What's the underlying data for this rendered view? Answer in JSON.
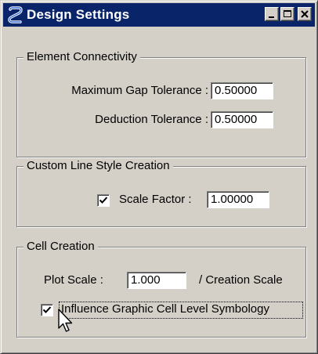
{
  "window": {
    "title": "Design Settings",
    "title_bar_color": "#0a246a",
    "face_color": "#d4d0c8",
    "controls": [
      "minimize-icon",
      "maximize-icon",
      "close-icon"
    ]
  },
  "element_connectivity": {
    "legend": "Element Connectivity",
    "max_gap_label": "Maximum Gap Tolerance :",
    "max_gap_value": "0.50000",
    "deduction_label": "Deduction Tolerance :",
    "deduction_value": "0.50000"
  },
  "custom_line_style": {
    "legend": "Custom Line Style Creation",
    "scale_factor_checked": true,
    "scale_factor_label": "Scale Factor :",
    "scale_factor_value": "1.00000"
  },
  "cell_creation": {
    "legend": "Cell Creation",
    "plot_scale_label": "Plot Scale :",
    "plot_scale_value": "1.000",
    "creation_scale_label": "/ Creation Scale",
    "influence_checked": true,
    "influence_label": "Influence Graphic Cell Level Symbology"
  }
}
